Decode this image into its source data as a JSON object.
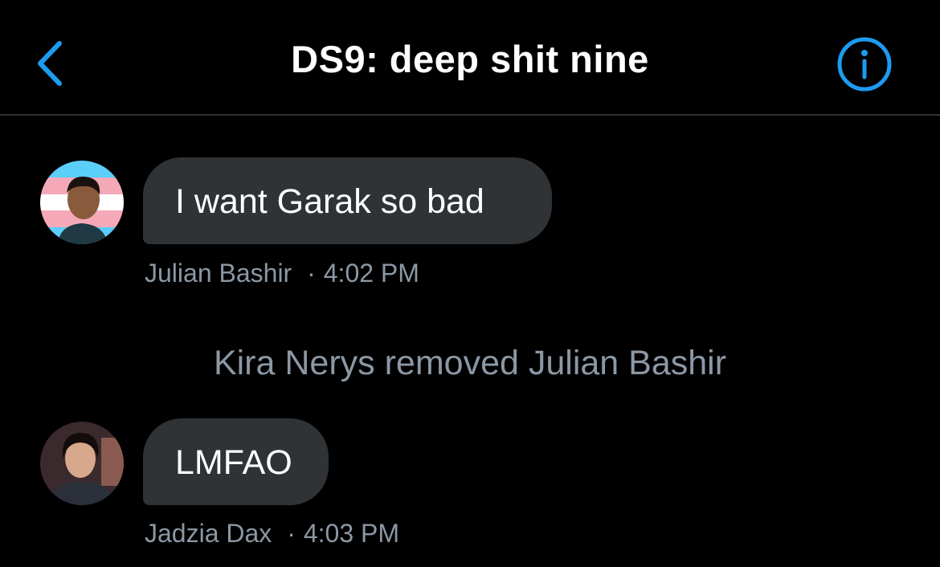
{
  "header": {
    "title": "DS9: deep shit nine",
    "back_icon": "chevron-left-icon",
    "info_icon": "info-circle-icon",
    "accent_color": "#1d9bf0"
  },
  "messages": [
    {
      "text": "I want Garak so bad",
      "sender": "Julian Bashir",
      "separator": "·",
      "time": "4:02 PM"
    },
    {
      "text": "LMFAO",
      "sender": "Jadzia Dax",
      "separator": "·",
      "time": "4:03 PM"
    }
  ],
  "system_message": "Kira Nerys removed Julian Bashir",
  "colors": {
    "background": "#000000",
    "bubble": "#2f3336",
    "meta_text": "#8b98a5",
    "divider": "#2f3336"
  }
}
